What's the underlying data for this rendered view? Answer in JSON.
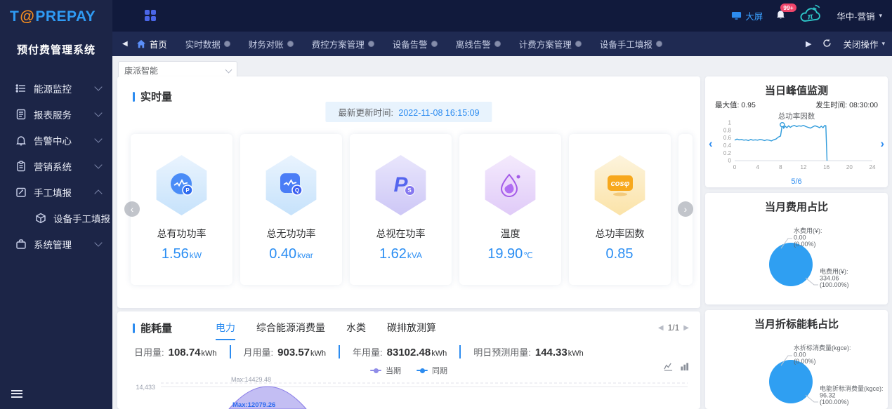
{
  "app": {
    "logo_t": "T",
    "logo_at": "@",
    "logo_rest": "PREPAY",
    "system_name": "预付费管理系统"
  },
  "header": {
    "big_screen": "大屏",
    "badge": "99+",
    "user": "华中-营销"
  },
  "tabbar": {
    "home": "首页",
    "tabs": [
      "实时数据",
      "财务对账",
      "费控方案管理",
      "设备告警",
      "离线告警",
      "计费方案管理",
      "设备手工填报"
    ],
    "close_ops": "关闭操作"
  },
  "sidebar": {
    "items": [
      {
        "label": "能源监控",
        "icon": "energy-monitor-icon"
      },
      {
        "label": "报表服务",
        "icon": "report-service-icon"
      },
      {
        "label": "告警中心",
        "icon": "alarm-center-icon"
      },
      {
        "label": "营销系统",
        "icon": "marketing-system-icon"
      },
      {
        "label": "手工填报",
        "icon": "manual-entry-icon",
        "expanded": true
      },
      {
        "label": "设备手工填报",
        "icon": "device-cube-icon",
        "sub": true
      },
      {
        "label": "系统管理",
        "icon": "system-management-icon"
      }
    ]
  },
  "content": {
    "filter_selected": "康派智能"
  },
  "realtime": {
    "title": "实时量",
    "update_label": "最新更新时间:",
    "update_time": "2022-11-08 16:15:09",
    "cards": [
      {
        "label": "总有功功率",
        "value": "1.56",
        "unit": "kW",
        "icon": "active-power-icon"
      },
      {
        "label": "总无功功率",
        "value": "0.40",
        "unit": "kvar",
        "icon": "reactive-power-icon"
      },
      {
        "label": "总视在功率",
        "value": "1.62",
        "unit": "kVA",
        "icon": "apparent-power-icon"
      },
      {
        "label": "温度",
        "value": "19.90",
        "unit": "℃",
        "icon": "temperature-icon"
      },
      {
        "label": "总功率因数",
        "value": "0.85",
        "unit": "",
        "icon": "power-factor-icon"
      }
    ]
  },
  "energy": {
    "title": "能耗量",
    "tabs": [
      "电力",
      "综合能源消费量",
      "水类",
      "碳排放测算"
    ],
    "active_tab": "电力",
    "pagination": "1/1",
    "stats": [
      {
        "label": "日用量:",
        "value": "108.74",
        "unit": "kWh"
      },
      {
        "label": "月用量:",
        "value": "903.57",
        "unit": "kWh"
      },
      {
        "label": "年用量:",
        "value": "83102.48",
        "unit": "kWh"
      },
      {
        "label": "明日预测用量:",
        "value": "144.33",
        "unit": "kWh"
      }
    ],
    "legend": [
      {
        "label": "当期",
        "color": "#8f8ce8"
      },
      {
        "label": "同期",
        "color": "#2d8cf0"
      }
    ]
  },
  "chart_data": [
    {
      "type": "line",
      "title": "当日峰值监测",
      "subtitle": "总功率因数",
      "max_label": "最大值:",
      "max_value": "0.95",
      "time_label": "发生时间:",
      "time_value": "08:30:00",
      "page": "5/6",
      "color": "#2f9bdb",
      "xlim": [
        0,
        24
      ],
      "ylim": [
        0,
        1
      ],
      "xticks": [
        0,
        4,
        8,
        12,
        16,
        20,
        24
      ],
      "yticks": [
        0,
        0.2,
        0.4,
        0.6,
        0.8,
        1
      ],
      "x": [
        0,
        0.4,
        0.8,
        1.2,
        1.6,
        2,
        2.4,
        2.8,
        3.2,
        3.6,
        4,
        4.4,
        4.8,
        5.2,
        5.6,
        6,
        6.4,
        6.8,
        7.2,
        7.6,
        8,
        8.3,
        8.55,
        8.8,
        9.1,
        9.4,
        9.7,
        10,
        10.4,
        10.8,
        11.2,
        11.6,
        12,
        12.4,
        12.8,
        13.2,
        13.6,
        14,
        14.4,
        14.8,
        15.1,
        15.4,
        15.7,
        15.9,
        16.1
      ],
      "y": [
        0.54,
        0.57,
        0.55,
        0.56,
        0.54,
        0.55,
        0.53,
        0.56,
        0.54,
        0.55,
        0.54,
        0.56,
        0.55,
        0.53,
        0.55,
        0.54,
        0.52,
        0.55,
        0.57,
        0.62,
        0.65,
        0.95,
        0.86,
        0.91,
        0.87,
        0.92,
        0.88,
        0.91,
        0.93,
        0.9,
        0.92,
        0.91,
        0.93,
        0.9,
        0.88,
        0.86,
        0.89,
        0.92,
        0.9,
        0.87,
        0.91,
        0.87,
        0.93,
        0.92,
        0.0
      ],
      "marker": [
        8.3,
        0.95
      ]
    },
    {
      "type": "pie",
      "title": "当月费用占比",
      "color": "#2f9ff2",
      "slices": [
        {
          "label": "水费用(¥)",
          "value": "0.00",
          "pct": "0.00%"
        },
        {
          "label": "电费用(¥)",
          "value": "334.06",
          "pct": "100.00%"
        }
      ]
    },
    {
      "type": "pie",
      "title": "当月折标能耗占比",
      "color": "#2f9ff2",
      "slices": [
        {
          "label": "水折标消费量(kgce)",
          "value": "0.00",
          "pct": "0.00%"
        },
        {
          "label": "电能折标消费量(kgce)",
          "value": "96.32",
          "pct": "100.00%"
        }
      ]
    },
    {
      "type": "area",
      "ytick": "14,433",
      "max_line_label": "Max:14429.48",
      "peak_label": "Max:12079.26",
      "area_color": "rgba(146,136,233,0.55)",
      "line_color": "#8d80e8",
      "label_color": "#2d6bf0"
    }
  ]
}
